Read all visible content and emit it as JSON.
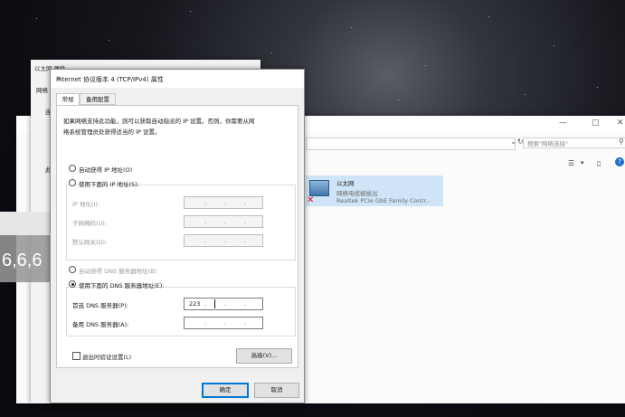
{
  "explorer": {
    "search_placeholder": "搜索\"网络连接\"",
    "adapter": {
      "name": "以太网",
      "status": "网络电缆被拔出",
      "device": "Realtek PCIe GbE Family Contr..."
    }
  },
  "back_dialog": {
    "title": "以太网 属性",
    "tab_label": "网络",
    "side_labels": [
      "连",
      "此"
    ]
  },
  "overlay_text": "6,6,6",
  "dialog": {
    "title": "Internet 协议版本 4 (TCP/IPv4) 属性",
    "tabs": [
      "常规",
      "备用配置"
    ],
    "description_lines": [
      "如果网络支持此功能，则可以获取自动指派的 IP 设置。否则，你需要从网",
      "络系统管理员处获得适当的 IP 设置。"
    ],
    "ip_auto_label": "自动获得 IP 地址(O)",
    "ip_manual_label": "使用下面的 IP 地址(S):",
    "ip_address_label": "IP 地址(I):",
    "subnet_label": "子网掩码(U):",
    "gateway_label": "默认网关(D):",
    "dns_auto_label": "自动获得 DNS 服务器地址(B)",
    "dns_manual_label": "使用下面的 DNS 服务器地址(E):",
    "preferred_dns_label": "首选 DNS 服务器(P):",
    "preferred_dns_value": "223",
    "alternate_dns_label": "备用 DNS 服务器(A):",
    "validate_label": "退出时验证设置(L)",
    "advanced_button": "高级(V)...",
    "ok_button": "确定",
    "cancel_button": "取消"
  }
}
